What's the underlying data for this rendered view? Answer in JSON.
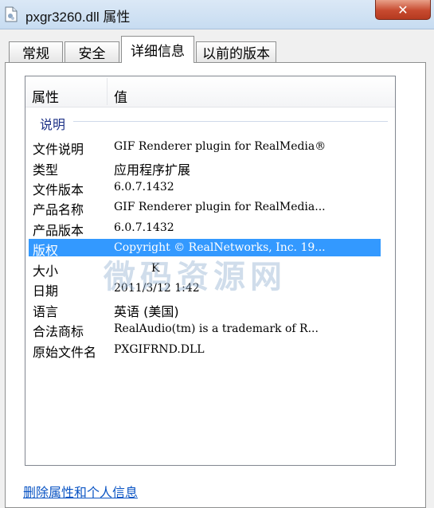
{
  "window": {
    "title": "pxgr3260.dll 属性",
    "close_glyph": "✕"
  },
  "tabs": [
    {
      "label": "常规",
      "active": false
    },
    {
      "label": "安全",
      "active": false
    },
    {
      "label": "详细信息",
      "active": true
    },
    {
      "label": "以前的版本",
      "active": false
    }
  ],
  "list": {
    "columns": [
      "属性",
      "值"
    ],
    "group_label": "说明",
    "rows": [
      {
        "label": "文件说明",
        "value": "GIF Renderer plugin for RealMedia®"
      },
      {
        "label": "类型",
        "value": "应用程序扩展"
      },
      {
        "label": "文件版本",
        "value": "6.0.7.1432"
      },
      {
        "label": "产品名称",
        "value": "GIF Renderer plugin for RealMedia..."
      },
      {
        "label": "产品版本",
        "value": "6.0.7.1432"
      },
      {
        "label": "版权",
        "value": "Copyright © RealNetworks, Inc. 19..."
      },
      {
        "label": "大小",
        "value": "K"
      },
      {
        "label": "日期",
        "value": "2011/3/12 1:42"
      },
      {
        "label": "语言",
        "value": "英语 (美国)"
      },
      {
        "label": "合法商标",
        "value": "RealAudio(tm) is a trademark of R..."
      },
      {
        "label": "原始文件名",
        "value": "PXGIFRND.DLL"
      }
    ],
    "selected_row": 5
  },
  "watermark": "微码资源网",
  "footer_link": "删除属性和个人信息"
}
